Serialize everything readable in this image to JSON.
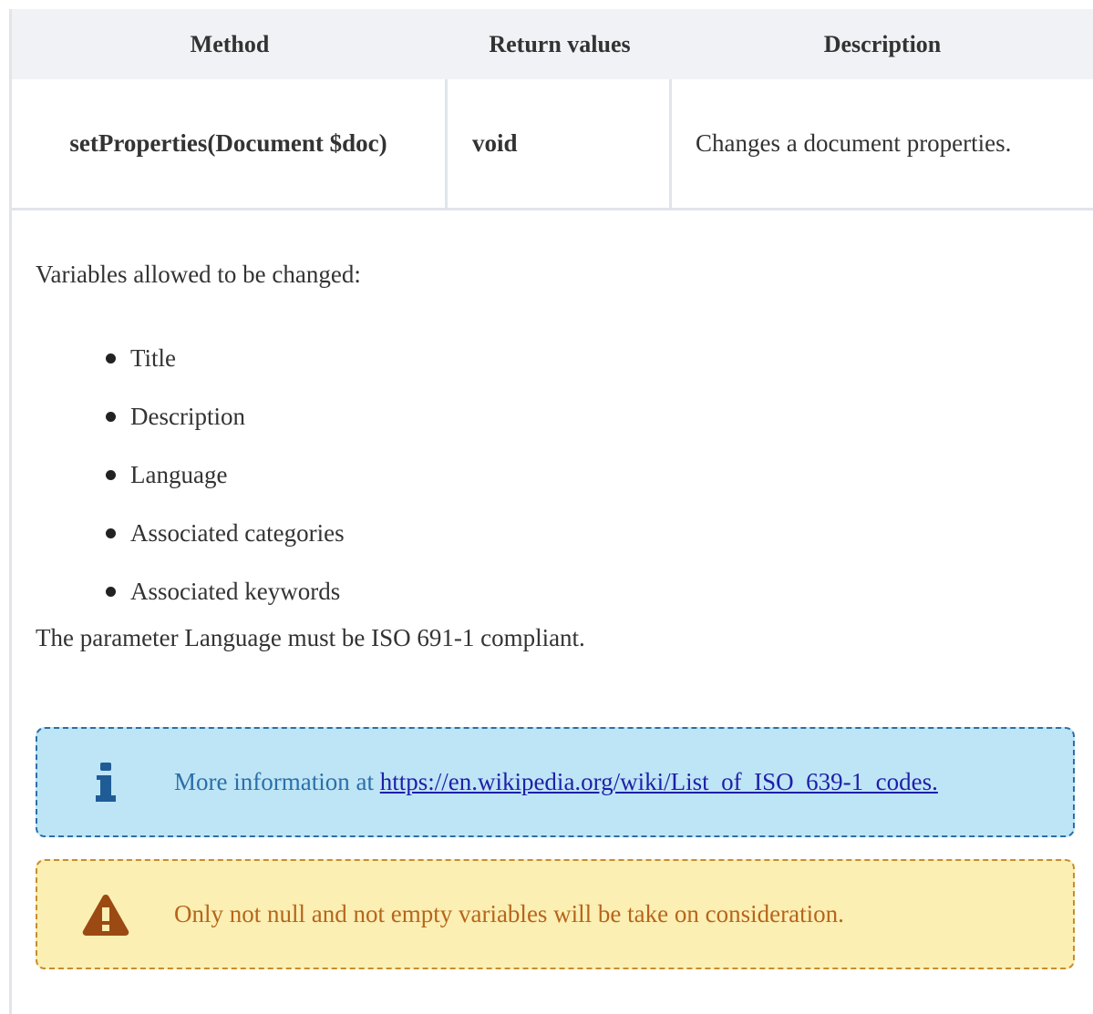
{
  "table": {
    "headers": {
      "method": "Method",
      "return_values": "Return values",
      "description": "Description"
    },
    "row": {
      "method": "setProperties(Document $doc)",
      "return_value": "void",
      "description": "Changes a document properties."
    }
  },
  "details": {
    "intro": "Variables allowed to be changed:",
    "variables": [
      "Title",
      "Description",
      "Language",
      "Associated categories",
      "Associated keywords"
    ],
    "language_note": "The parameter Language must be ISO 691-1 compliant."
  },
  "info_callout": {
    "text": "More information at",
    "link": "https://en.wikipedia.org/wiki/List_of_ISO_639-1_codes.",
    "icon": "info-icon"
  },
  "warning_callout": {
    "text": "Only not null and not empty variables will be take on consideration.",
    "icon": "warning-icon"
  },
  "colors": {
    "header_bg": "#f0f2f5",
    "border": "#e1e5ea",
    "info_bg": "#bee5f6",
    "info_fg": "#2b6fa8",
    "warn_bg": "#fcefb3",
    "warn_fg": "#b5651d"
  }
}
